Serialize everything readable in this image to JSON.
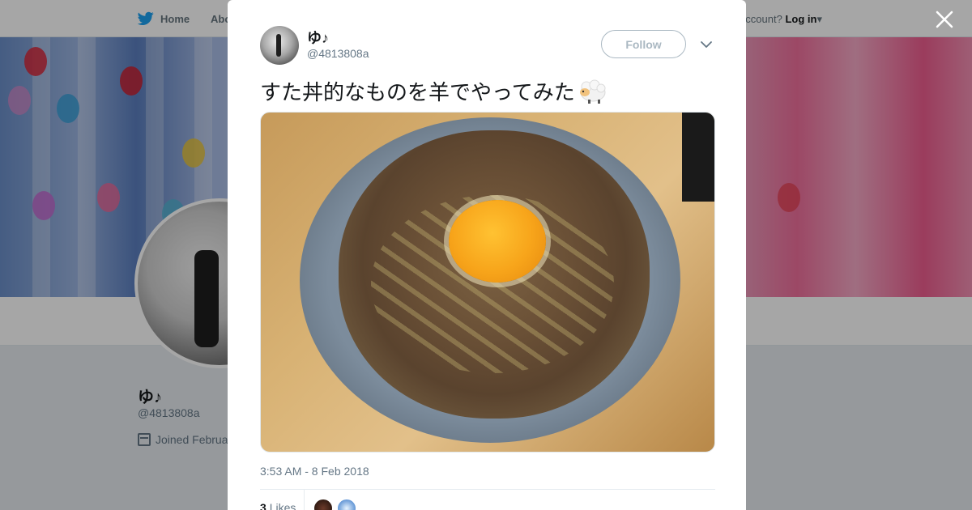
{
  "nav": {
    "home_label": "Home",
    "about_label": "Abo",
    "account_prompt": "account?",
    "login_label": "Log in"
  },
  "profile": {
    "name": "ゆ♪",
    "handle": "@4813808a",
    "joined": "Joined Februa"
  },
  "tweet": {
    "author_name": "ゆ♪",
    "author_handle": "@4813808a",
    "follow_label": "Follow",
    "text": "すた丼的なものを羊でやってみた",
    "emoji": "sheep-emoji",
    "timestamp": "3:53 AM - 8 Feb 2018",
    "likes_count": "3",
    "likes_label": "Likes"
  },
  "icons": {
    "close": "close-icon",
    "twitter": "twitter-bird-icon",
    "caret": "caret-down-icon",
    "calendar": "calendar-icon"
  },
  "colors": {
    "brand": "#1da1f2",
    "text_secondary": "#657786",
    "border": "#aab8c2"
  }
}
